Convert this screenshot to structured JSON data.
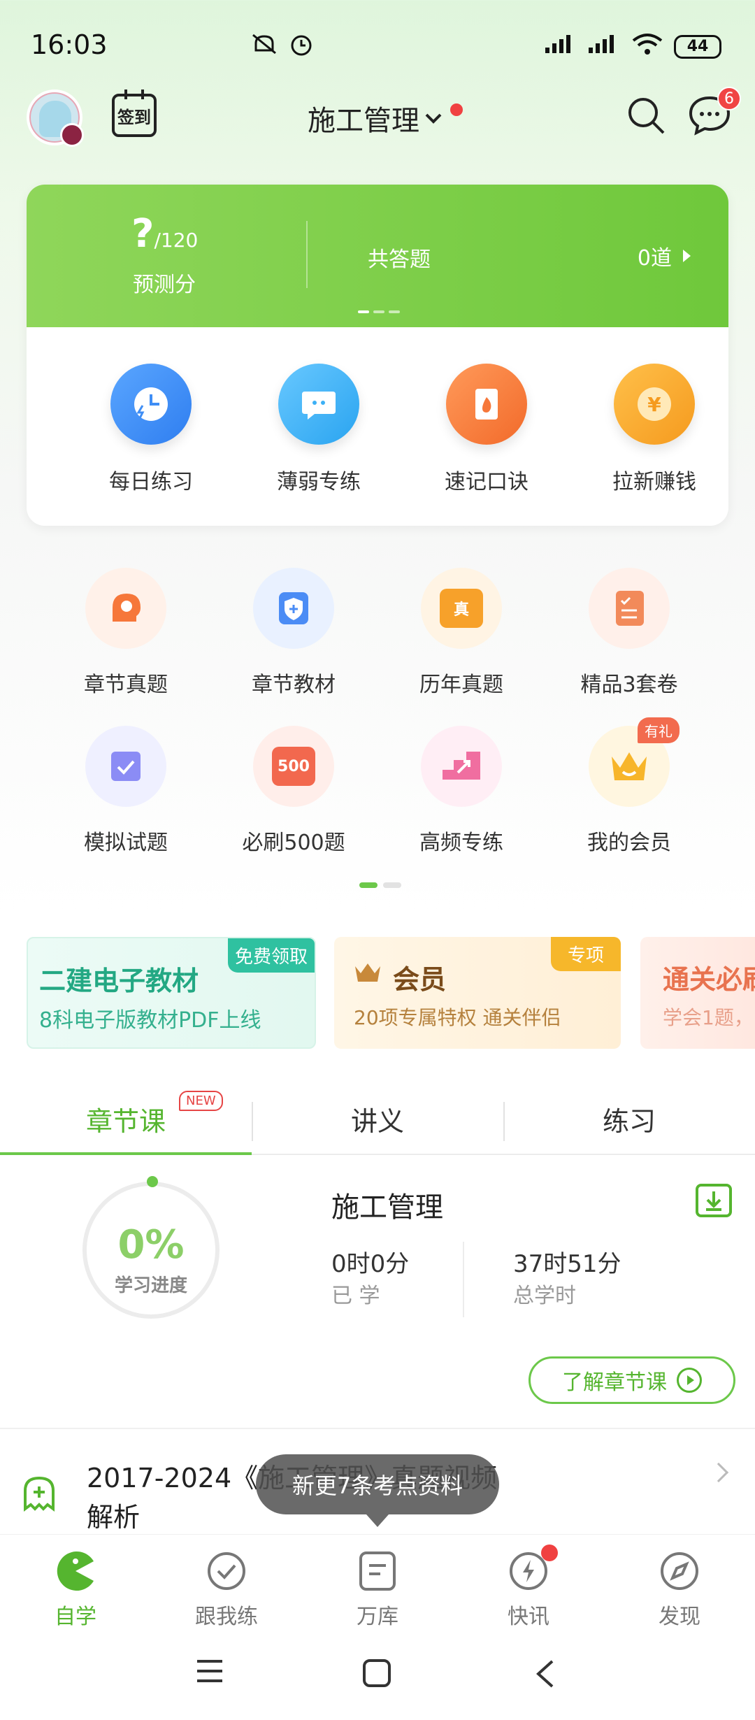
{
  "status_bar": {
    "time": "16:03",
    "battery": "44"
  },
  "header": {
    "signin_label": "签到",
    "title": "施工管理",
    "message_count": "6"
  },
  "score_card": {
    "score": "?",
    "score_max": "/120",
    "score_label": "预测分",
    "total_label": "共答题",
    "total_value": "0道"
  },
  "features": [
    {
      "label": "每日练习",
      "icon": "clock-lightning-icon",
      "color": "#3f8ef5"
    },
    {
      "label": "薄弱专练",
      "icon": "chat-bubble-icon",
      "color": "#3cb0f5"
    },
    {
      "label": "速记口诀",
      "icon": "flame-book-icon",
      "color": "#f6773a"
    },
    {
      "label": "拉新赚钱",
      "icon": "yen-coin-icon",
      "color": "#f7a12a"
    }
  ],
  "grid": [
    {
      "label": "章节真题",
      "icon": "gear-head-icon",
      "color": "#f6773a",
      "bg": "#fff1e9"
    },
    {
      "label": "章节教材",
      "icon": "shield-plus-icon",
      "color": "#4b8cf5",
      "bg": "#e9f1ff"
    },
    {
      "label": "历年真题",
      "icon": "folder-zhen-icon",
      "color": "#f7a12a",
      "bg": "#fff4e4",
      "text": "真"
    },
    {
      "label": "精品3套卷",
      "icon": "checklist-icon",
      "color": "#f28a5a",
      "bg": "#fff0ea"
    },
    {
      "label": "模拟试题",
      "icon": "exam-scroll-icon",
      "color": "#8b8cf5",
      "bg": "#eff0ff"
    },
    {
      "label": "必刷500题",
      "icon": "500-card-icon",
      "color": "#f2684e",
      "bg": "#ffeeea",
      "text": "500"
    },
    {
      "label": "高频专练",
      "icon": "stairs-arrow-icon",
      "color": "#f06ea0",
      "bg": "#ffeef5"
    },
    {
      "label": "我的会员",
      "icon": "crown-icon",
      "color": "#f7b52a",
      "bg": "#fff6e0"
    }
  ],
  "gift_badge": "有礼",
  "banners": {
    "b1": {
      "title": "二建电子教材",
      "subtitle": "8科电子版教材PDF上线",
      "tag": "免费领取"
    },
    "b2": {
      "title": "会员",
      "subtitle": "20项专属特权  通关伴侣",
      "tag": "专项"
    },
    "b3": {
      "title": "通关必刷",
      "subtitle": "学会1题，"
    }
  },
  "tabs": [
    "章节课",
    "讲义",
    "练习"
  ],
  "new_tag": "NEW",
  "progress": {
    "percent": "0%",
    "percent_label": "学习进度",
    "course_name": "施工管理",
    "studied_value": "0时0分",
    "studied_label": "已 学",
    "total_value": "37时51分",
    "total_label": "总学时",
    "learn_button": "了解章节课"
  },
  "list_item": {
    "text": "2017-2024《施工管理》真题视频解析"
  },
  "toast": "新更7条考点资料",
  "bottom_nav": [
    {
      "label": "自学",
      "icon": "pacman-icon"
    },
    {
      "label": "跟我练",
      "icon": "check-circle-icon"
    },
    {
      "label": "万库",
      "icon": "document-icon"
    },
    {
      "label": "快讯",
      "icon": "lightning-icon"
    },
    {
      "label": "发现",
      "icon": "compass-icon"
    }
  ],
  "colors": {
    "accent": "#6cc84a",
    "accent_dark": "#55b52f",
    "badge_red": "#f04141"
  }
}
